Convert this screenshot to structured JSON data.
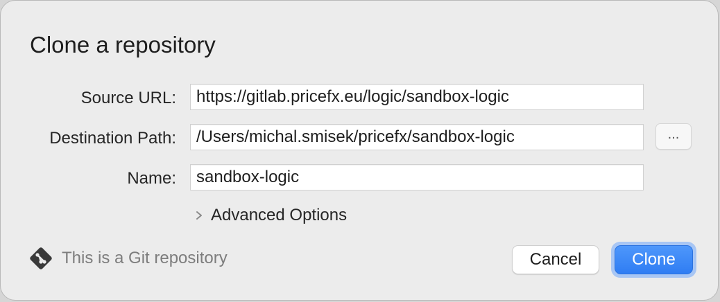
{
  "dialog": {
    "title": "Clone a repository",
    "fields": {
      "source_url": {
        "label": "Source URL:",
        "value": "https://gitlab.pricefx.eu/logic/sandbox-logic"
      },
      "destination_path": {
        "label": "Destination Path:",
        "value": "/Users/michal.smisek/pricefx/sandbox-logic",
        "browse_label": "..."
      },
      "name": {
        "label": "Name:",
        "value": "sandbox-logic"
      }
    },
    "advanced_options_label": "Advanced Options",
    "git_status": {
      "text": "This is a Git repository",
      "icon": "git-icon"
    },
    "buttons": {
      "cancel": "Cancel",
      "clone": "Clone"
    }
  },
  "colors": {
    "accent": "#3b87f7",
    "focus_ring": "#a8c6f4",
    "background": "#ececec",
    "muted_text": "#7d7d7d"
  }
}
